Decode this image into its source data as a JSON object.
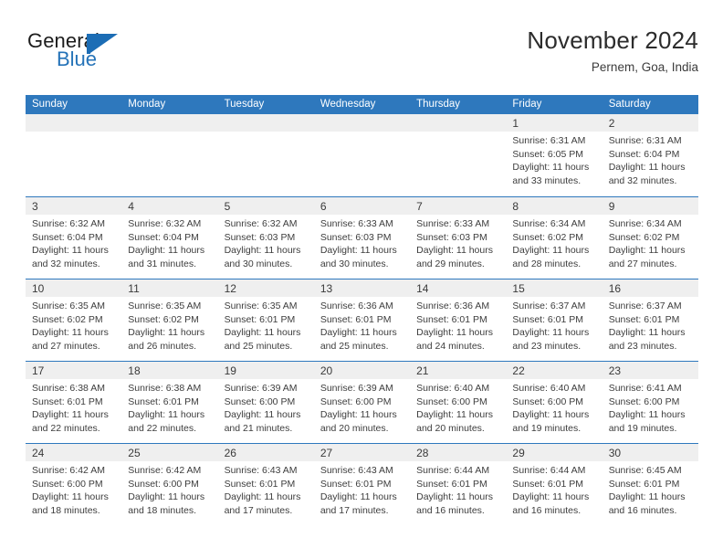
{
  "brand": {
    "name_part1": "General",
    "name_part2": "Blue",
    "flag_icon": "flag-triangle-icon"
  },
  "header": {
    "title": "November 2024",
    "subtitle": "Pernem, Goa, India"
  },
  "colors": {
    "header_blue": "#2e78bd",
    "brand_blue": "#2573b8",
    "day_band_gray": "#efefef",
    "text": "#3d3d3d"
  },
  "weekdays": [
    "Sunday",
    "Monday",
    "Tuesday",
    "Wednesday",
    "Thursday",
    "Friday",
    "Saturday"
  ],
  "labels": {
    "sunrise_prefix": "Sunrise:",
    "sunset_prefix": "Sunset:",
    "daylight_prefix": "Daylight:"
  },
  "weeks": [
    [
      {
        "day": "",
        "sunrise": "",
        "sunset": "",
        "daylight": ""
      },
      {
        "day": "",
        "sunrise": "",
        "sunset": "",
        "daylight": ""
      },
      {
        "day": "",
        "sunrise": "",
        "sunset": "",
        "daylight": ""
      },
      {
        "day": "",
        "sunrise": "",
        "sunset": "",
        "daylight": ""
      },
      {
        "day": "",
        "sunrise": "",
        "sunset": "",
        "daylight": ""
      },
      {
        "day": "1",
        "sunrise": "Sunrise: 6:31 AM",
        "sunset": "Sunset: 6:05 PM",
        "daylight": "Daylight: 11 hours and 33 minutes."
      },
      {
        "day": "2",
        "sunrise": "Sunrise: 6:31 AM",
        "sunset": "Sunset: 6:04 PM",
        "daylight": "Daylight: 11 hours and 32 minutes."
      }
    ],
    [
      {
        "day": "3",
        "sunrise": "Sunrise: 6:32 AM",
        "sunset": "Sunset: 6:04 PM",
        "daylight": "Daylight: 11 hours and 32 minutes."
      },
      {
        "day": "4",
        "sunrise": "Sunrise: 6:32 AM",
        "sunset": "Sunset: 6:04 PM",
        "daylight": "Daylight: 11 hours and 31 minutes."
      },
      {
        "day": "5",
        "sunrise": "Sunrise: 6:32 AM",
        "sunset": "Sunset: 6:03 PM",
        "daylight": "Daylight: 11 hours and 30 minutes."
      },
      {
        "day": "6",
        "sunrise": "Sunrise: 6:33 AM",
        "sunset": "Sunset: 6:03 PM",
        "daylight": "Daylight: 11 hours and 30 minutes."
      },
      {
        "day": "7",
        "sunrise": "Sunrise: 6:33 AM",
        "sunset": "Sunset: 6:03 PM",
        "daylight": "Daylight: 11 hours and 29 minutes."
      },
      {
        "day": "8",
        "sunrise": "Sunrise: 6:34 AM",
        "sunset": "Sunset: 6:02 PM",
        "daylight": "Daylight: 11 hours and 28 minutes."
      },
      {
        "day": "9",
        "sunrise": "Sunrise: 6:34 AM",
        "sunset": "Sunset: 6:02 PM",
        "daylight": "Daylight: 11 hours and 27 minutes."
      }
    ],
    [
      {
        "day": "10",
        "sunrise": "Sunrise: 6:35 AM",
        "sunset": "Sunset: 6:02 PM",
        "daylight": "Daylight: 11 hours and 27 minutes."
      },
      {
        "day": "11",
        "sunrise": "Sunrise: 6:35 AM",
        "sunset": "Sunset: 6:02 PM",
        "daylight": "Daylight: 11 hours and 26 minutes."
      },
      {
        "day": "12",
        "sunrise": "Sunrise: 6:35 AM",
        "sunset": "Sunset: 6:01 PM",
        "daylight": "Daylight: 11 hours and 25 minutes."
      },
      {
        "day": "13",
        "sunrise": "Sunrise: 6:36 AM",
        "sunset": "Sunset: 6:01 PM",
        "daylight": "Daylight: 11 hours and 25 minutes."
      },
      {
        "day": "14",
        "sunrise": "Sunrise: 6:36 AM",
        "sunset": "Sunset: 6:01 PM",
        "daylight": "Daylight: 11 hours and 24 minutes."
      },
      {
        "day": "15",
        "sunrise": "Sunrise: 6:37 AM",
        "sunset": "Sunset: 6:01 PM",
        "daylight": "Daylight: 11 hours and 23 minutes."
      },
      {
        "day": "16",
        "sunrise": "Sunrise: 6:37 AM",
        "sunset": "Sunset: 6:01 PM",
        "daylight": "Daylight: 11 hours and 23 minutes."
      }
    ],
    [
      {
        "day": "17",
        "sunrise": "Sunrise: 6:38 AM",
        "sunset": "Sunset: 6:01 PM",
        "daylight": "Daylight: 11 hours and 22 minutes."
      },
      {
        "day": "18",
        "sunrise": "Sunrise: 6:38 AM",
        "sunset": "Sunset: 6:01 PM",
        "daylight": "Daylight: 11 hours and 22 minutes."
      },
      {
        "day": "19",
        "sunrise": "Sunrise: 6:39 AM",
        "sunset": "Sunset: 6:00 PM",
        "daylight": "Daylight: 11 hours and 21 minutes."
      },
      {
        "day": "20",
        "sunrise": "Sunrise: 6:39 AM",
        "sunset": "Sunset: 6:00 PM",
        "daylight": "Daylight: 11 hours and 20 minutes."
      },
      {
        "day": "21",
        "sunrise": "Sunrise: 6:40 AM",
        "sunset": "Sunset: 6:00 PM",
        "daylight": "Daylight: 11 hours and 20 minutes."
      },
      {
        "day": "22",
        "sunrise": "Sunrise: 6:40 AM",
        "sunset": "Sunset: 6:00 PM",
        "daylight": "Daylight: 11 hours and 19 minutes."
      },
      {
        "day": "23",
        "sunrise": "Sunrise: 6:41 AM",
        "sunset": "Sunset: 6:00 PM",
        "daylight": "Daylight: 11 hours and 19 minutes."
      }
    ],
    [
      {
        "day": "24",
        "sunrise": "Sunrise: 6:42 AM",
        "sunset": "Sunset: 6:00 PM",
        "daylight": "Daylight: 11 hours and 18 minutes."
      },
      {
        "day": "25",
        "sunrise": "Sunrise: 6:42 AM",
        "sunset": "Sunset: 6:00 PM",
        "daylight": "Daylight: 11 hours and 18 minutes."
      },
      {
        "day": "26",
        "sunrise": "Sunrise: 6:43 AM",
        "sunset": "Sunset: 6:01 PM",
        "daylight": "Daylight: 11 hours and 17 minutes."
      },
      {
        "day": "27",
        "sunrise": "Sunrise: 6:43 AM",
        "sunset": "Sunset: 6:01 PM",
        "daylight": "Daylight: 11 hours and 17 minutes."
      },
      {
        "day": "28",
        "sunrise": "Sunrise: 6:44 AM",
        "sunset": "Sunset: 6:01 PM",
        "daylight": "Daylight: 11 hours and 16 minutes."
      },
      {
        "day": "29",
        "sunrise": "Sunrise: 6:44 AM",
        "sunset": "Sunset: 6:01 PM",
        "daylight": "Daylight: 11 hours and 16 minutes."
      },
      {
        "day": "30",
        "sunrise": "Sunrise: 6:45 AM",
        "sunset": "Sunset: 6:01 PM",
        "daylight": "Daylight: 11 hours and 16 minutes."
      }
    ]
  ]
}
